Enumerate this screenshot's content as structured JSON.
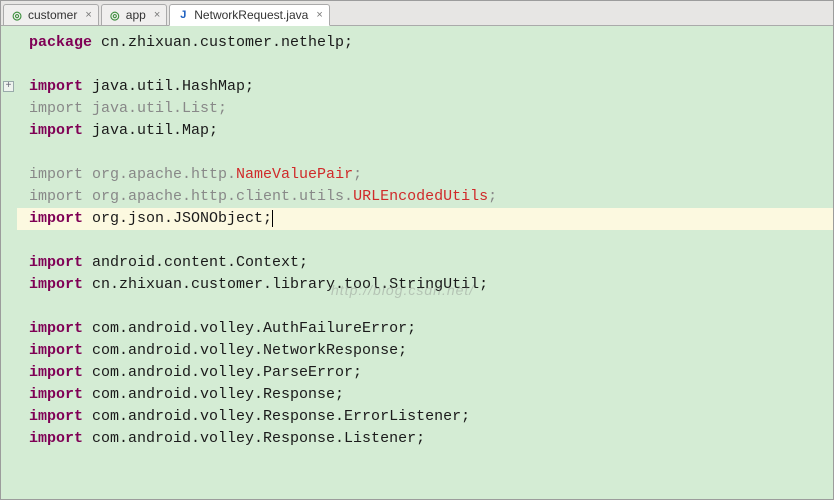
{
  "tabs": [
    {
      "label": "customer",
      "icon": "java-green"
    },
    {
      "label": "app",
      "icon": "java-green"
    },
    {
      "label": "NetworkRequest.java",
      "icon": "java-blue",
      "active": true
    }
  ],
  "watermark": "http://blog.csdn.net/",
  "code_lines": [
    {
      "segments": [
        {
          "t": "package ",
          "c": "kw"
        },
        {
          "t": "cn.zhixuan.customer.nethelp;",
          "c": "txt"
        }
      ]
    },
    {
      "blank": true
    },
    {
      "segments": [
        {
          "t": "import ",
          "c": "kw"
        },
        {
          "t": "java.util.HashMap;",
          "c": "txt"
        }
      ],
      "expand_marker": true
    },
    {
      "segments": [
        {
          "t": "import ",
          "c": "dim"
        },
        {
          "t": "java.util.List;",
          "c": "dim"
        }
      ]
    },
    {
      "segments": [
        {
          "t": "import ",
          "c": "kw"
        },
        {
          "t": "java.util.Map;",
          "c": "txt"
        }
      ]
    },
    {
      "blank": true
    },
    {
      "segments": [
        {
          "t": "import ",
          "c": "dim"
        },
        {
          "t": "org.apache.http.",
          "c": "dim"
        },
        {
          "t": "NameValuePair",
          "c": "err"
        },
        {
          "t": ";",
          "c": "dim"
        }
      ]
    },
    {
      "segments": [
        {
          "t": "import ",
          "c": "dim"
        },
        {
          "t": "org.apache.http.client.utils.",
          "c": "dim"
        },
        {
          "t": "URLEncodedUtils",
          "c": "err"
        },
        {
          "t": ";",
          "c": "dim"
        }
      ]
    },
    {
      "segments": [
        {
          "t": "import ",
          "c": "kw"
        },
        {
          "t": "org.json.JSONObject;",
          "c": "txt"
        }
      ],
      "current": true,
      "caret_after": true
    },
    {
      "blank": true
    },
    {
      "segments": [
        {
          "t": "import ",
          "c": "kw"
        },
        {
          "t": "android.content.Context;",
          "c": "txt"
        }
      ]
    },
    {
      "segments": [
        {
          "t": "import ",
          "c": "kw"
        },
        {
          "t": "cn.zhixuan.customer.library.tool.StringUtil;",
          "c": "txt"
        }
      ]
    },
    {
      "blank": true
    },
    {
      "segments": [
        {
          "t": "import ",
          "c": "kw"
        },
        {
          "t": "com.android.volley.AuthFailureError;",
          "c": "txt"
        }
      ]
    },
    {
      "segments": [
        {
          "t": "import ",
          "c": "kw"
        },
        {
          "t": "com.android.volley.NetworkResponse;",
          "c": "txt"
        }
      ]
    },
    {
      "segments": [
        {
          "t": "import ",
          "c": "kw"
        },
        {
          "t": "com.android.volley.ParseError;",
          "c": "txt"
        }
      ]
    },
    {
      "segments": [
        {
          "t": "import ",
          "c": "kw"
        },
        {
          "t": "com.android.volley.Response;",
          "c": "txt"
        }
      ]
    },
    {
      "segments": [
        {
          "t": "import ",
          "c": "kw"
        },
        {
          "t": "com.android.volley.Response.ErrorListener;",
          "c": "txt"
        }
      ]
    },
    {
      "segments": [
        {
          "t": "import ",
          "c": "kw"
        },
        {
          "t": "com.android.volley.Response.Listener;",
          "c": "txt"
        }
      ]
    }
  ]
}
